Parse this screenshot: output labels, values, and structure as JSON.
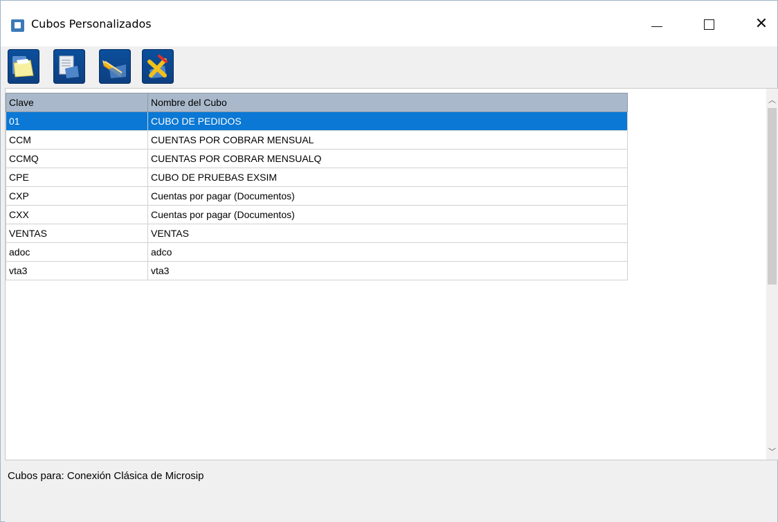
{
  "window": {
    "title": "Cubos Personalizados",
    "controls": {
      "minimize": "minimize-icon",
      "maximize": "maximize-icon",
      "close": "close-icon"
    }
  },
  "toolbar": {
    "buttons": [
      {
        "name": "open-button",
        "icon": "folder-open-icon"
      },
      {
        "name": "new-button",
        "icon": "new-document-icon"
      },
      {
        "name": "edit-button",
        "icon": "pencil-icon"
      },
      {
        "name": "delete-button",
        "icon": "delete-x-icon"
      }
    ]
  },
  "grid": {
    "columns": [
      "Clave",
      "Nombre del Cubo"
    ],
    "rows": [
      {
        "clave": "01",
        "nombre": "CUBO DE PEDIDOS"
      },
      {
        "clave": "CCM",
        "nombre": "CUENTAS POR COBRAR MENSUAL"
      },
      {
        "clave": "CCMQ",
        "nombre": "CUENTAS POR COBRAR MENSUALQ"
      },
      {
        "clave": "CPE",
        "nombre": "CUBO DE PRUEBAS EXSIM"
      },
      {
        "clave": "CXP",
        "nombre": "Cuentas por pagar (Documentos)"
      },
      {
        "clave": "CXX",
        "nombre": "Cuentas por pagar (Documentos)"
      },
      {
        "clave": "VENTAS",
        "nombre": "VENTAS"
      },
      {
        "clave": "adoc",
        "nombre": "adco"
      },
      {
        "clave": "vta3",
        "nombre": "vta3"
      }
    ],
    "selected_index": 0
  },
  "colors": {
    "selection": "#0a78d4",
    "header": "#a9b9cb",
    "toolbar_button": "#0b4f9c"
  },
  "status": {
    "text": "Cubos para: Conexión Clásica de Microsip"
  }
}
